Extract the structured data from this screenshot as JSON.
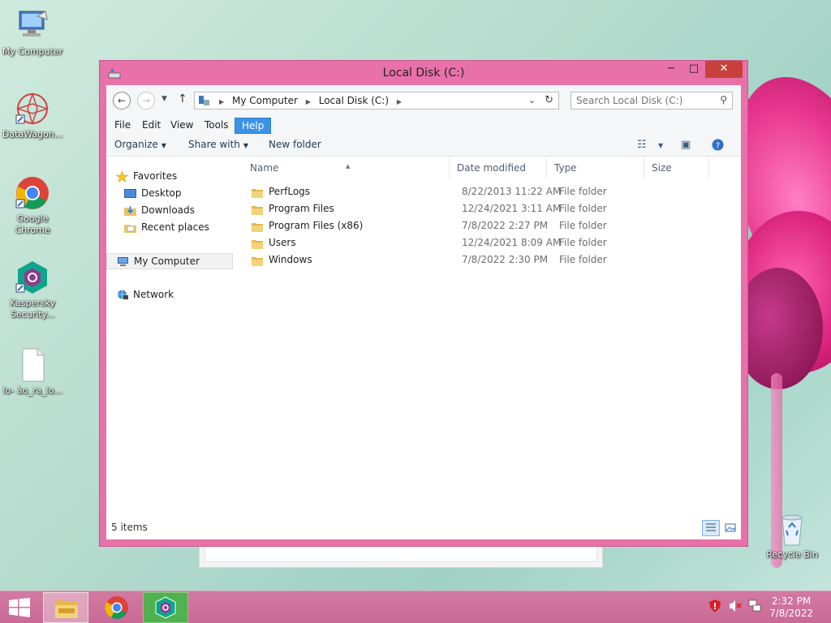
{
  "desktop": {
    "icons": [
      {
        "label": "My Computer"
      },
      {
        "label": "DataWagon..."
      },
      {
        "label": "Google Chrome"
      },
      {
        "label": "Kaspersky Security..."
      },
      {
        "label": "lo- ào_ra_lo..."
      },
      {
        "label": "Recycle Bin"
      }
    ]
  },
  "window": {
    "title": "Local Disk (C:)",
    "controls": {
      "minimize": "−",
      "maximize": "□",
      "close": "✕"
    }
  },
  "address": {
    "crumbs": [
      "My Computer",
      "Local Disk (C:)"
    ],
    "search_placeholder": "Search Local Disk (C:)"
  },
  "menu": [
    "File",
    "Edit",
    "View",
    "Tools",
    "Help"
  ],
  "menu_active": "Help",
  "commands": {
    "organize": "Organize",
    "share_with": "Share with",
    "new_folder": "New folder"
  },
  "nav": {
    "favorites": "Favorites",
    "desktop": "Desktop",
    "downloads": "Downloads",
    "recent_places": "Recent places",
    "my_computer": "My Computer",
    "network": "Network"
  },
  "columns": {
    "name": "Name",
    "date": "Date modified",
    "type": "Type",
    "size": "Size"
  },
  "files": [
    {
      "name": "PerfLogs",
      "date": "8/22/2013 11:22 AM",
      "type": "File folder"
    },
    {
      "name": "Program Files",
      "date": "12/24/2021 3:11 AM",
      "type": "File folder"
    },
    {
      "name": "Program Files (x86)",
      "date": "7/8/2022 2:27 PM",
      "type": "File folder"
    },
    {
      "name": "Users",
      "date": "12/24/2021 8:09 AM",
      "type": "File folder"
    },
    {
      "name": "Windows",
      "date": "7/8/2022 2:30 PM",
      "type": "File folder"
    }
  ],
  "status": {
    "items": "5 items"
  },
  "taskbar": {
    "time": "2:32 PM",
    "date": "7/8/2022"
  },
  "colors": {
    "window_frame": "#e871a9",
    "close_button": "#c7403a",
    "menu_highlight": "#3c93e6",
    "taskbar": "#c96a96"
  }
}
